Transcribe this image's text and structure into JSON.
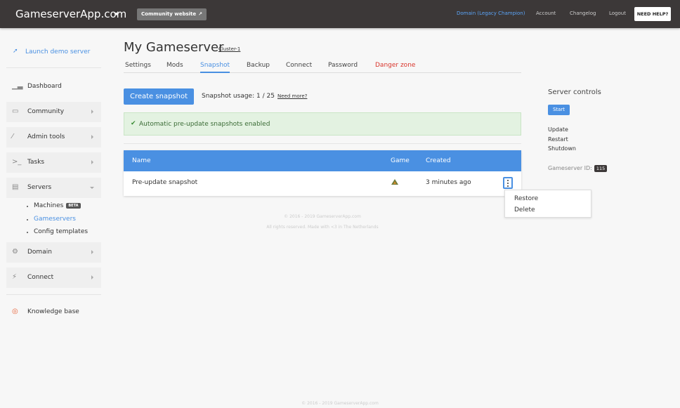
{
  "topbar": {
    "brand": "GameserverApp.com",
    "community_label": "Community website",
    "domain_link": "Domain (Legacy Champion)",
    "account": "Account",
    "changelog": "Changelog",
    "logout": "Logout",
    "help": "NEED HELP?"
  },
  "sidebar": {
    "launch": "Launch demo server",
    "items": [
      {
        "label": "Dashboard"
      },
      {
        "label": "Community"
      },
      {
        "label": "Admin tools"
      },
      {
        "label": "Tasks"
      },
      {
        "label": "Servers"
      },
      {
        "label": "Domain"
      },
      {
        "label": "Connect"
      },
      {
        "label": "Knowledge base"
      }
    ],
    "sub": [
      {
        "label": "Machines",
        "badge": "BETA"
      },
      {
        "label": "Gameservers"
      },
      {
        "label": "Config templates"
      }
    ]
  },
  "main": {
    "title": "My Gameserver",
    "cluster": "Cluster-1",
    "tabs": [
      "Settings",
      "Mods",
      "Snapshot",
      "Backup",
      "Connect",
      "Password",
      "Danger zone"
    ],
    "create_btn": "Create snapshot",
    "usage": "Snapshot usage: 1 / 25",
    "need_more": "Need more?",
    "alert": "Automatic pre-update snapshots enabled",
    "table": {
      "headers": [
        "Name",
        "Game",
        "Created"
      ],
      "rows": [
        {
          "name": "Pre-update snapshot",
          "created": "3 minutes ago"
        }
      ]
    },
    "dropdown": [
      "Restore",
      "Delete"
    ],
    "footer1": "© 2016 - 2019 GameserverApp.com",
    "footer2": "All rights reserved. Made with <3 in The Netherlands",
    "footer3": "© 2016 - 2019 GameserverApp.com"
  },
  "controls": {
    "title": "Server controls",
    "start": "Start",
    "update": "Update",
    "restart": "Restart",
    "shutdown": "Shutdown",
    "id_label": "Gameserver ID:",
    "id_value": "115"
  },
  "colors": {
    "accent": "#4a90e2",
    "topbar": "#3c3838",
    "danger": "#d9342b",
    "success_bg": "#e3f2e1"
  }
}
